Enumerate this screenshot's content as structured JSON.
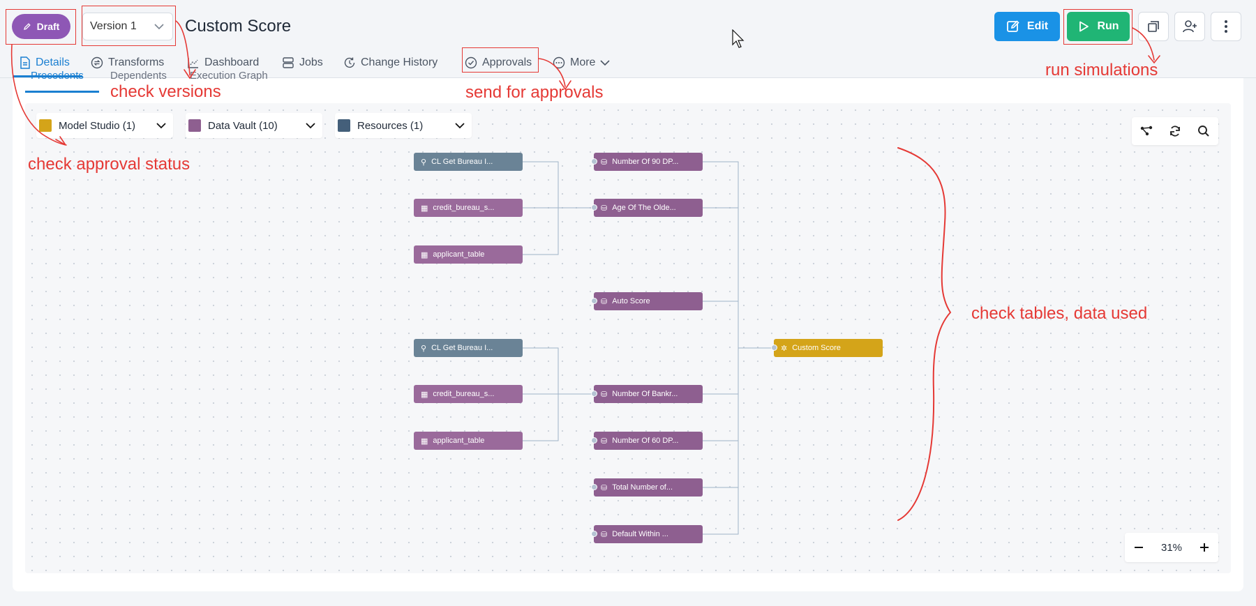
{
  "header": {
    "status": "Draft",
    "version": "Version 1",
    "title": "Custom Score",
    "edit_label": "Edit",
    "run_label": "Run"
  },
  "tabs": [
    {
      "label": "Details",
      "icon": "document-icon"
    },
    {
      "label": "Transforms",
      "icon": "transform-icon"
    },
    {
      "label": "Dashboard",
      "icon": "dashboard-icon"
    },
    {
      "label": "Jobs",
      "icon": "jobs-icon"
    },
    {
      "label": "Change History",
      "icon": "history-icon"
    },
    {
      "label": "Approvals",
      "icon": "check-circle-icon"
    },
    {
      "label": "More",
      "icon": "more-icon"
    }
  ],
  "sub_tabs": [
    "Precedents",
    "Dependents",
    "Execution Graph"
  ],
  "filters": [
    {
      "label": "Model Studio (1)",
      "color": "#d4a419"
    },
    {
      "label": "Data Vault (10)",
      "color": "#8e5f90"
    },
    {
      "label": "Resources (1)",
      "color": "#445f7a"
    }
  ],
  "nodes": {
    "r1": "CL Get Bureau I...",
    "t1": "credit_bureau_s...",
    "t2": "applicant_table",
    "r2": "CL Get Bureau I...",
    "t3": "credit_bureau_s...",
    "t4": "applicant_table",
    "v1": "Number Of 90 DP...",
    "v2": "Age Of The Olde...",
    "v3": "Auto Score",
    "v4": "Number Of Bankr...",
    "v5": "Number Of 60 DP...",
    "v6": "Total Number of...",
    "v7": "Default Within ...",
    "m1": "Custom Score"
  },
  "zoom": "31%",
  "annotations": {
    "approval_status": "check approval status",
    "versions": "check versions",
    "approvals": "send for approvals",
    "run": "run simulations",
    "tables": "check tables, data used"
  },
  "colors": {
    "accent": "#1a7fd1",
    "draft": "#8e57b5",
    "edit": "#1a92e6",
    "run": "#20b575",
    "annotation": "#e53935"
  }
}
